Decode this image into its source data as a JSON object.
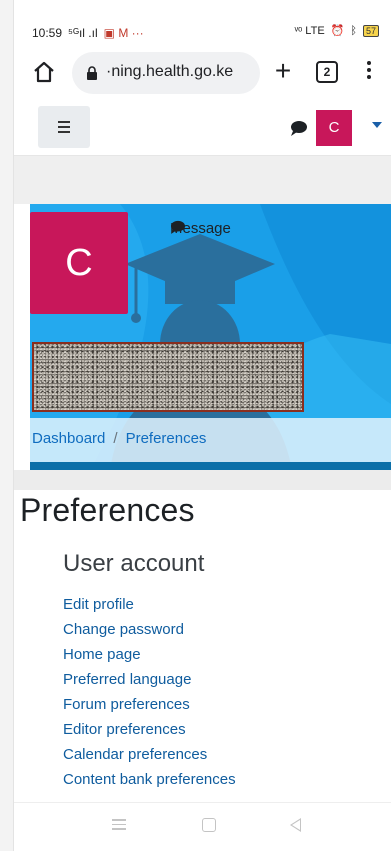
{
  "status_bar": {
    "time": "10:59",
    "signal_text": "⁵ᴳıl .ıl",
    "notif_icons": "▣ M ···",
    "right_text": "ᵛᵒ LTE",
    "battery": "57"
  },
  "browser": {
    "url": "·ning.health.go.ke",
    "tab_count": "2"
  },
  "navbar": {
    "avatar_initial": "C"
  },
  "profile_header": {
    "avatar_initial": "C",
    "message_label": "Message"
  },
  "breadcrumb": {
    "items": [
      "Dashboard",
      "Preferences"
    ],
    "separator": "/"
  },
  "page": {
    "title": "Preferences",
    "section_title": "User account",
    "links": [
      "Edit profile",
      "Change password",
      "Home page",
      "Preferred language",
      "Forum preferences",
      "Editor preferences",
      "Calendar preferences",
      "Content bank preferences"
    ]
  },
  "colors": {
    "brand": "#c8175a",
    "link": "#0f6cbf",
    "hero": "#1a9fe8"
  }
}
